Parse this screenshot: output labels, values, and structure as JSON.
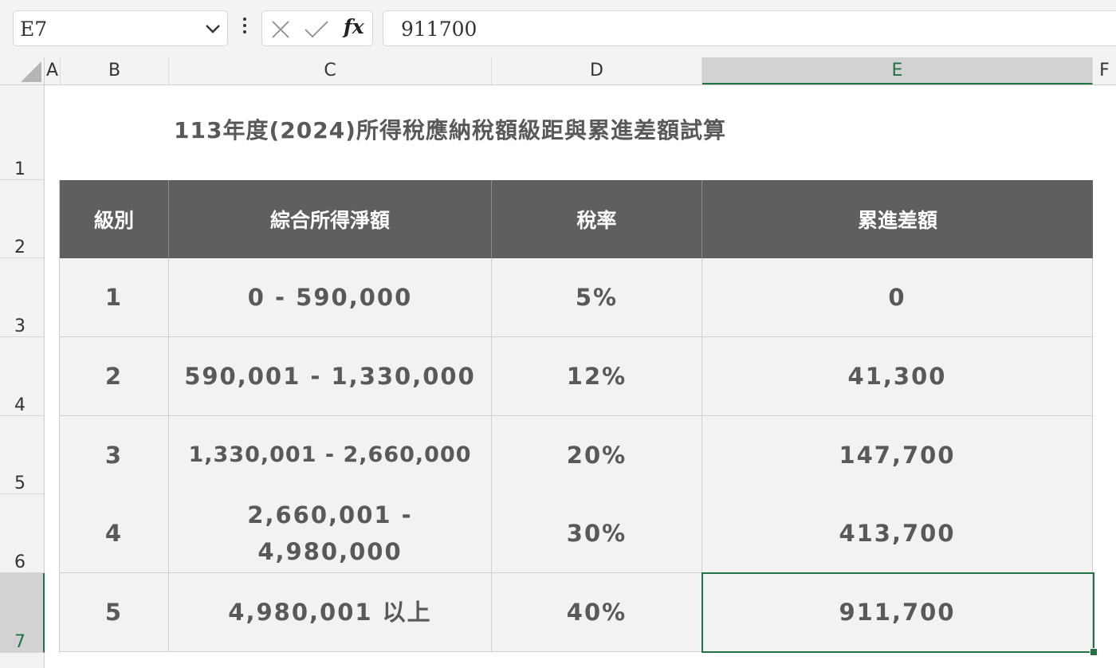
{
  "formula_bar": {
    "name_box": "E7",
    "formula_value": "911700",
    "fx_label": "fx"
  },
  "columns": [
    "A",
    "B",
    "C",
    "D",
    "E",
    "F"
  ],
  "rows": [
    "1",
    "2",
    "3",
    "4",
    "5",
    "6",
    "7"
  ],
  "selected_cell": {
    "column": "E",
    "row": "7"
  },
  "sheet": {
    "title": "113年度(2024)所得稅應納稅額級距與累進差額試算",
    "headers": {
      "level": "級別",
      "income": "綜合所得淨額",
      "rate": "稅率",
      "diff": "累進差額"
    },
    "rows": [
      {
        "level": "1",
        "income": "0 - 590,000",
        "rate": "5%",
        "diff": "0"
      },
      {
        "level": "2",
        "income": "590,001 - 1,330,000",
        "rate": "12%",
        "diff": "41,300"
      },
      {
        "level": "3",
        "income": "1,330,001 - 2,660,000",
        "rate": "20%",
        "diff": "147,700"
      },
      {
        "level": "4",
        "income": "2,660,001 - 4,980,000",
        "rate": "30%",
        "diff": "413,700"
      },
      {
        "level": "5",
        "income": "4,980,001 以上",
        "rate": "40%",
        "diff": "911,700"
      }
    ]
  },
  "colors": {
    "accent_green": "#217346",
    "table_header_bg": "#5f5f5f",
    "cell_bg": "#f2f2f2"
  }
}
